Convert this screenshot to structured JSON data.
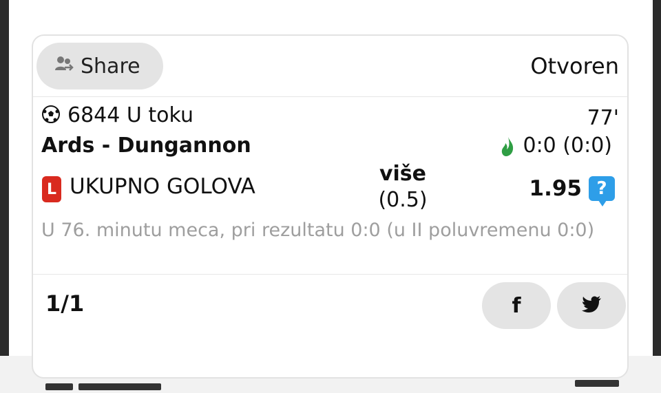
{
  "card": {
    "share_label": "Share",
    "status": "Otvoren"
  },
  "match": {
    "id_status": "6844 U toku",
    "minute": "77'",
    "teams": "Ards - Dungannon",
    "score": "0:0 (0:0)"
  },
  "bet": {
    "badge": "L",
    "market": "UKUPNO GOLOVA",
    "pick_line1": "više",
    "pick_line2": "(0.5)",
    "odds": "1.95",
    "help_symbol": "?",
    "description": "U 76. minutu meca, pri rezultatu 0:0 (u II poluvremenu 0:0)"
  },
  "footer": {
    "count": "1/1",
    "facebook_label": "f"
  },
  "colors": {
    "badge_red": "#d92a1f",
    "help_blue": "#2e9ee8",
    "flame_green": "#2f9e44",
    "button_gray": "#e4e4e4"
  },
  "icons": [
    "share-people-icon",
    "soccer-ball-icon",
    "live-flame-icon",
    "help-icon",
    "facebook-icon",
    "twitter-icon"
  ]
}
